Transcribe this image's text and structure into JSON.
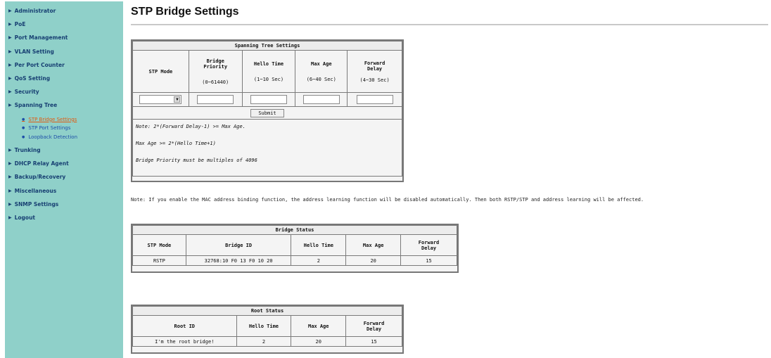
{
  "sidebar": {
    "items": [
      {
        "label": "Administrator"
      },
      {
        "label": "PoE"
      },
      {
        "label": "Port Management"
      },
      {
        "label": "VLAN Setting"
      },
      {
        "label": "Per Port Counter"
      },
      {
        "label": "QoS Setting"
      },
      {
        "label": "Security"
      },
      {
        "label": "Spanning Tree"
      }
    ],
    "sub_items": [
      {
        "label": "STP Bridge Settings"
      },
      {
        "label": "STP Port Settings"
      },
      {
        "label": "Loopback Detection"
      }
    ],
    "items_after": [
      {
        "label": "Trunking"
      },
      {
        "label": "DHCP Relay Agent"
      },
      {
        "label": "Backup/Recovery"
      },
      {
        "label": "Miscellaneous"
      },
      {
        "label": "SNMP Settings"
      },
      {
        "label": "Logout"
      }
    ]
  },
  "page": {
    "title": "STP Bridge Settings"
  },
  "spanning_tree": {
    "header": "Spanning Tree Settings",
    "columns": {
      "stp_mode": "STP Mode",
      "bridge_priority": "Bridge Priority",
      "bridge_priority_range": "(0~61440)",
      "hello_time": "Hello Time",
      "hello_time_range": "(1~10 Sec)",
      "max_age": "Max Age",
      "max_age_range": "(6~40 Sec)",
      "forward_delay": "Forward Delay",
      "forward_delay_range": "(4~30 Sec)"
    },
    "submit_label": "Submit",
    "notes": [
      "Note: 2*(Forward Delay-1) >= Max Age.",
      "Max Age >= 2*(Hello Time+1)",
      "Bridge Priority must be multiples of 4096"
    ]
  },
  "mac_note": "Note: If you enable the MAC address binding function, the address learning function will be disabled automatically. Then both RSTP/STP and address learning will be affected.",
  "bridge_status": {
    "header": "Bridge Status",
    "columns": [
      "STP Mode",
      "Bridge ID",
      "Hello Time",
      "Max Age",
      "Forward Delay"
    ],
    "row": [
      "RSTP",
      "32768:10 F0 13 F0 10 20",
      "2",
      "20",
      "15"
    ]
  },
  "root_status": {
    "header": "Root Status",
    "columns": [
      "Root ID",
      "Hello Time",
      "Max Age",
      "Forward Delay"
    ],
    "row": [
      "I'm the root bridge!",
      "2",
      "20",
      "15"
    ]
  }
}
